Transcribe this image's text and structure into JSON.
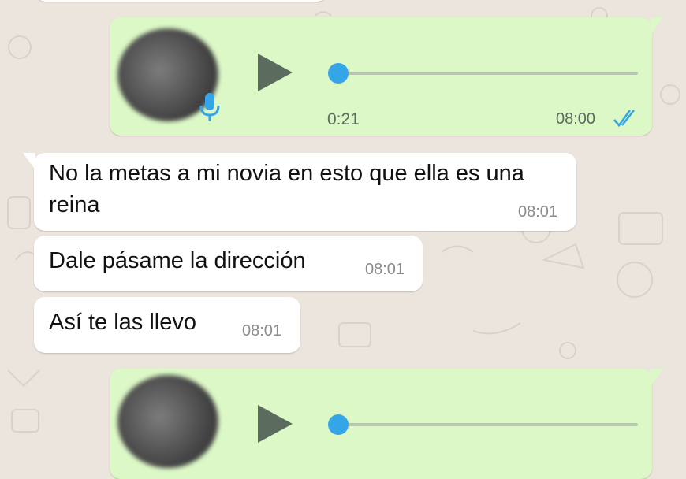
{
  "voice_note_1": {
    "duration": "0:21",
    "time": "08:00",
    "status": "read"
  },
  "messages": [
    {
      "text": "No la metas a mi novia en esto que ella es una reina",
      "time": "08:01"
    },
    {
      "text": "Dale pásame la dirección",
      "time": "08:01"
    },
    {
      "text": "Así te las llevo",
      "time": "08:01"
    }
  ],
  "colors": {
    "outgoing_bubble": "#dcf8c6",
    "incoming_bubble": "#ffffff",
    "read_ticks": "#34a5e6",
    "chat_background": "#ece5dd"
  },
  "icons": [
    "play-icon",
    "microphone-icon",
    "double-check-icon"
  ]
}
